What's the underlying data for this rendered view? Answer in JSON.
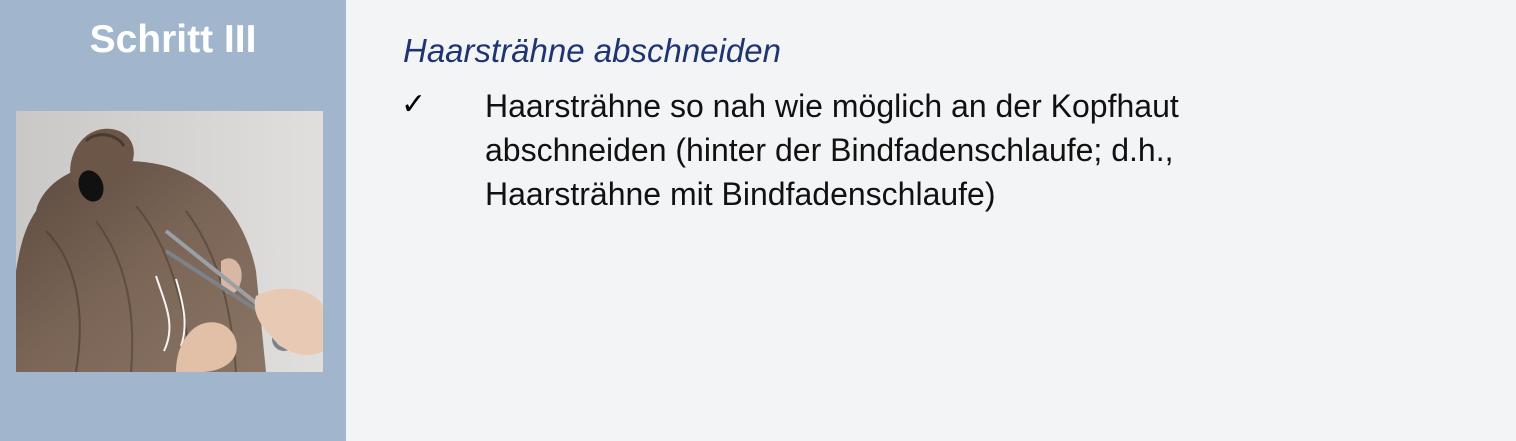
{
  "step": {
    "title": "Schritt III"
  },
  "photo": {
    "subject": "scissors-cutting-hair-strand"
  },
  "content": {
    "subtitle": "Haarsträhne abschneiden",
    "bullets": [
      {
        "icon": "checkmark-icon",
        "lines": [
          "Haarsträhne so nah wie möglich an der Kopfhaut",
          "abschneiden (hinter der Bindfadenschlaufe; d.h.,",
          "Haarsträhne mit Bindfadenschlaufe)"
        ]
      }
    ]
  },
  "colors": {
    "sidebar": "#a1b6cd",
    "background": "#f3f4f6",
    "subtitle": "#1f3572"
  }
}
